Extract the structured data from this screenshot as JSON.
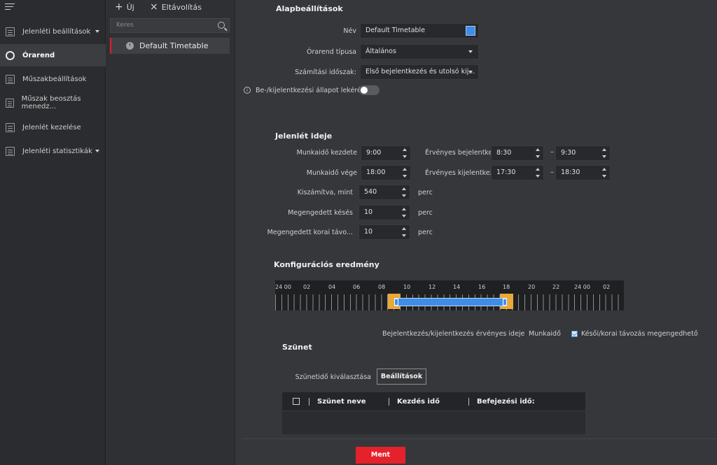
{
  "nav": {
    "items": [
      {
        "label": "Jelenléti beállítások",
        "icon": "calendar-icon",
        "has_caret": true
      },
      {
        "label": "Órarend",
        "icon": "clock-icon",
        "active": true
      },
      {
        "label": "Műszakbeállítások",
        "icon": "shift-icon"
      },
      {
        "label": "Műszak beosztás menedz...",
        "icon": "schedule-icon"
      },
      {
        "label": "Jelenlét kezelése",
        "icon": "checklist-icon"
      },
      {
        "label": "Jelenléti statisztikák",
        "icon": "stats-icon",
        "has_caret": true
      }
    ]
  },
  "toolbar": {
    "new_label": "Új",
    "remove_label": "Eltávolítás"
  },
  "search": {
    "placeholder": "Keres"
  },
  "timetables": {
    "items": [
      {
        "label": "Default Timetable"
      }
    ]
  },
  "basic": {
    "title": "Alapbeállítások",
    "name_label": "Név",
    "name_value": "Default Timetable",
    "name_color": "#3e8ee8",
    "type_label": "Órarend típusa",
    "type_value": "Általános",
    "calc_label": "Számítási időszak:",
    "calc_value": "Első bejelentkezés és utolsó kij...",
    "status_label": "Be-/kijelentkezési állapot lekérése ...",
    "status_enabled": false
  },
  "attendance": {
    "title": "Jelenlét ideje",
    "start_label": "Munkaidő kezdete",
    "start_value": "9:00",
    "end_label": "Munkaidő vége",
    "end_value": "18:00",
    "valid_in_label": "Érvényes bejelentke...",
    "valid_in_from": "8:30",
    "valid_in_to": "9:30",
    "valid_out_label": "Érvényes kijelentkez...",
    "valid_out_from": "17:30",
    "valid_out_to": "18:30",
    "dash": "–",
    "counted_label": "Kiszámítva, mint",
    "counted_value": "540",
    "late_label": "Megengedett késés",
    "late_value": "10",
    "early_label": "Megengedett korai távo...",
    "early_value": "10",
    "unit": "perc"
  },
  "config": {
    "title": "Konfigurációs eredmény",
    "ticks": [
      "24 00",
      "02",
      "04",
      "06",
      "08",
      "10",
      "12",
      "14",
      "16",
      "18",
      "20",
      "22",
      "24 00",
      "02"
    ],
    "legend_valid": "Bejelentkezés/kijelentkezés érvényes ideje",
    "legend_work": "Munkaidő",
    "legend_allow": "Késői/korai távozás megengedhető",
    "colors": {
      "valid": "#e9a83a",
      "work": "#3e8ee8"
    }
  },
  "break": {
    "title": "Szünet",
    "select_label": "Szünetidő kiválasztása",
    "settings_label": "Beállítások",
    "columns": [
      "Szünet neve",
      "Kezdés idő",
      "Befejezési idő:"
    ]
  },
  "footer": {
    "save_label": "Ment"
  }
}
